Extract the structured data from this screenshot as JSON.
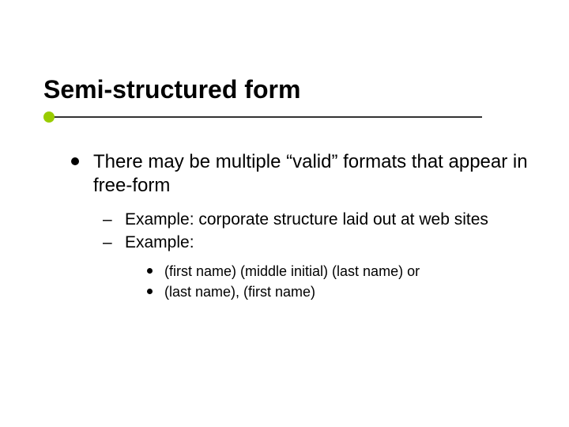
{
  "title": "Semi-structured form",
  "bullets": {
    "lvl1": "There may be multiple “valid” formats that appear in free-form",
    "lvl2": [
      "Example: corporate structure laid out at web sites",
      "Example:"
    ],
    "lvl3": [
      "(first name) (middle initial) (last name) or",
      "(last name), (first name)"
    ]
  },
  "colors": {
    "accent": "#99cc00",
    "rule": "#333333"
  }
}
